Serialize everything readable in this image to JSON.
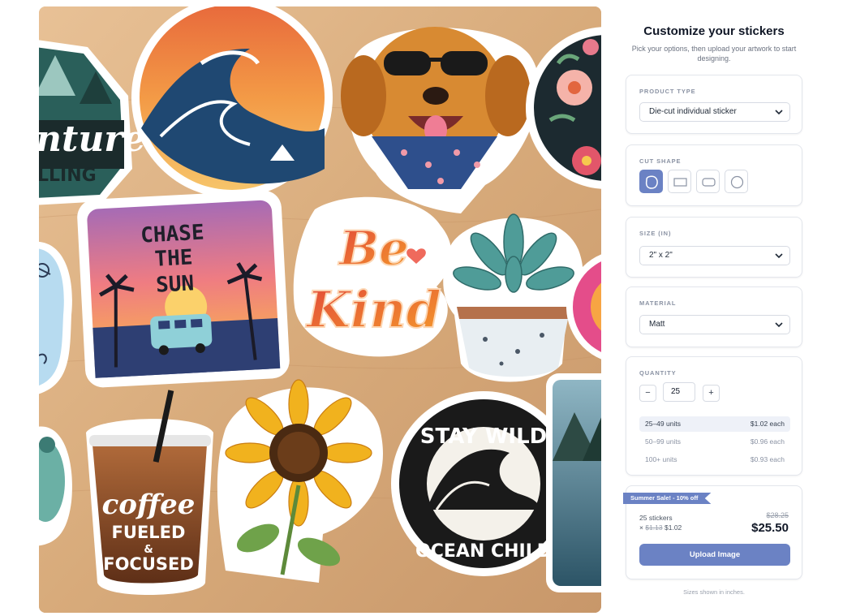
{
  "hero": {
    "sticker_texts": {
      "adventure_top": "nture",
      "adventure_bottom": "LLING",
      "chase_1": "CHASE",
      "chase_2": "THE",
      "chase_3": "SUN",
      "be": "Be",
      "kind": "Kind",
      "coffee": "coffee",
      "fueled": "FUELED",
      "amp": "&",
      "focused": "FOCUSED",
      "stay_wild": "STAY WILD",
      "ocean_child": "OCEAN CHILD"
    }
  },
  "panel": {
    "title": "Customize your stickers",
    "subtitle_line1": "Pick your options, then upload your artwork to start",
    "subtitle_line2": "designing."
  },
  "product_type": {
    "label": "PRODUCT TYPE",
    "value": "Die-cut individual sticker"
  },
  "cut_shape": {
    "label": "CUT SHAPE",
    "options": [
      "die-cut",
      "rectangle",
      "rounded-rectangle",
      "circle"
    ],
    "selected": "die-cut"
  },
  "size": {
    "label": "SIZE (IN)",
    "value": "2\" x 2\""
  },
  "material": {
    "label": "MATERIAL",
    "value": "Matt"
  },
  "quantity": {
    "label": "QUANTITY",
    "minus": "−",
    "value": "25",
    "plus": "+",
    "tiers": [
      {
        "range": "25–49 units",
        "price": "$1.02 each"
      },
      {
        "range": "50–99 units",
        "price": "$0.96 each"
      },
      {
        "range": "100+ units",
        "price": "$0.93 each"
      }
    ]
  },
  "summary": {
    "badge": "Summer Sale! - 10% off",
    "count": "25 stickers",
    "times": "×",
    "old_unit": "$1.13",
    "new_unit": "$1.02",
    "old_total": "$28.25",
    "total": "$25.50",
    "upload_label": "Upload Image"
  },
  "footnote": "Sizes shown in inches.",
  "colors": {
    "accent": "#6b82c4",
    "text": "#111827",
    "muted": "#8a92a3"
  }
}
